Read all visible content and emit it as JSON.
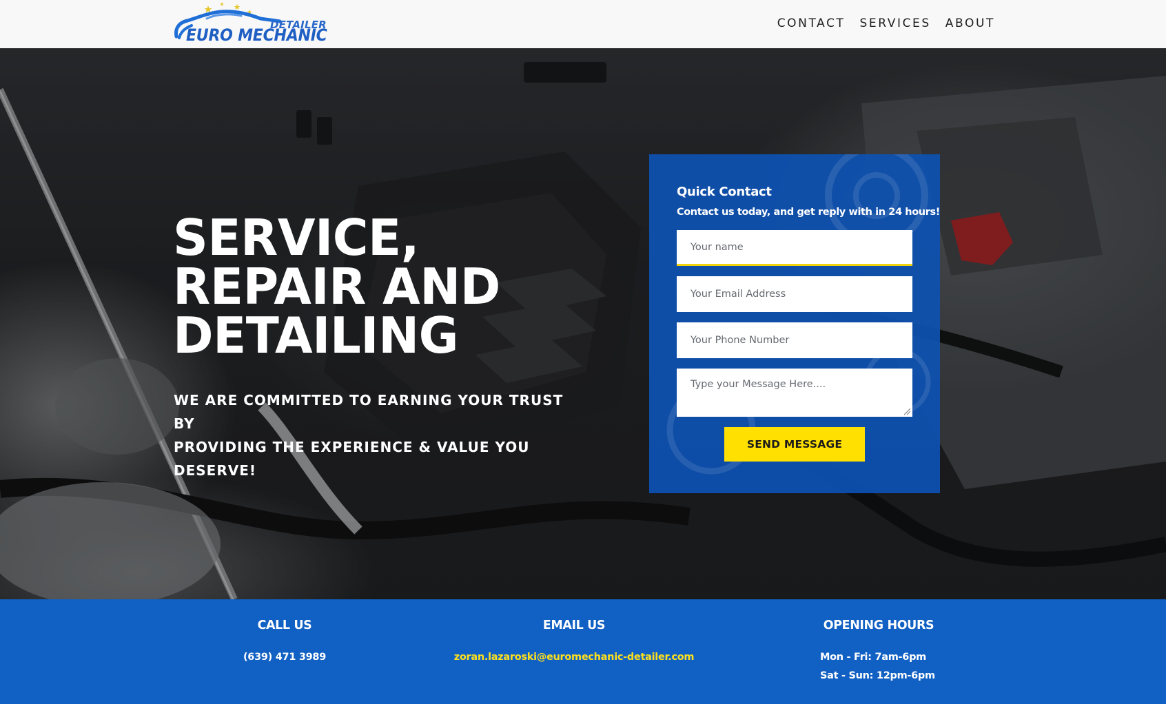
{
  "header": {
    "logo": {
      "top_text": "DETAILER",
      "main_text": "EURO MECHANIC"
    },
    "nav": [
      {
        "label": "CONTACT"
      },
      {
        "label": "SERVICES"
      },
      {
        "label": "ABOUT"
      }
    ]
  },
  "hero": {
    "title_lines": [
      "SERVICE,",
      "REPAIR AND",
      "DETAILING"
    ],
    "subtitle_lines": [
      "WE ARE COMMITTED TO EARNING YOUR TRUST BY",
      "PROVIDING THE EXPERIENCE & VALUE YOU DESERVE!"
    ]
  },
  "contact_form": {
    "title": "Quick Contact",
    "subtitle": "Contact us today, and get reply with in 24 hours!",
    "name_placeholder": "Your name",
    "email_placeholder": "Your Email Address",
    "phone_placeholder": "Your Phone Number",
    "message_placeholder": "Type your Message Here....",
    "submit_label": "SEND MESSAGE"
  },
  "info_bar": {
    "call": {
      "heading": "CALL US",
      "value": "(639) 471 3989"
    },
    "email": {
      "heading": "EMAIL US",
      "value": "zoran.lazaroski@euromechanic-detailer.com"
    },
    "hours": {
      "heading": "OPENING HOURS",
      "lines": [
        "Mon - Fri: 7am-6pm",
        "Sat - Sun: 12pm-6pm"
      ]
    }
  },
  "colors": {
    "brand_blue": "#1160c3",
    "card_blue": "#0e52b2",
    "accent_yellow": "#ffe000",
    "header_bg": "#f8f8f8"
  }
}
